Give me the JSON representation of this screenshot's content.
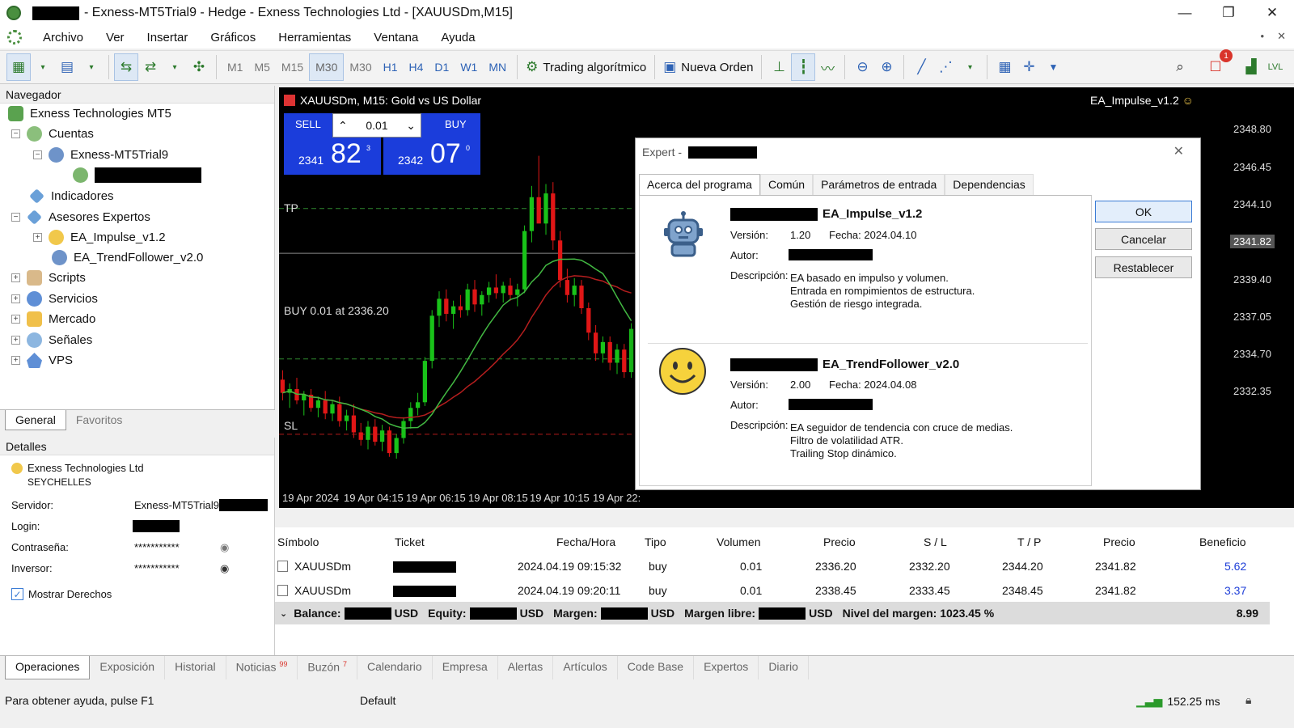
{
  "window": {
    "title": "- Exness-MT5Trial9 - Hedge - Exness Technologies Ltd - [XAUUSDm,M15]",
    "minimize": "—",
    "maximize": "❐",
    "close": "✕"
  },
  "menu": [
    "Archivo",
    "Ver",
    "Insertar",
    "Gráficos",
    "Herramientas",
    "Ventana",
    "Ayuda"
  ],
  "toolbar": {
    "timeframes": [
      "M1",
      "M5",
      "M15",
      "M30",
      "M30",
      "H1",
      "H4",
      "D1",
      "W1",
      "MN"
    ],
    "algo_trading": "Trading algorítmico",
    "new_order": "Nueva Orden",
    "notifications_count": "1",
    "lvl": "LVL"
  },
  "navigator": {
    "title": "Navegador",
    "root": "Exness Technologies MT5",
    "cuentas": "Cuentas",
    "account": "Exness-MT5Trial9",
    "indicadores": "Indicadores",
    "asesores": "Asesores Expertos",
    "ea1": "EA_Impulse_v1.2",
    "ea2": "EA_TrendFollower_v2.0",
    "scripts": "Scripts",
    "servicios": "Servicios",
    "mercado": "Mercado",
    "senales": "Señales",
    "vps": "VPS",
    "tab_general": "General",
    "tab_favoritos": "Favoritos"
  },
  "details": {
    "title": "Detalles",
    "company": "Exness Technologies Ltd",
    "country": "SEYCHELLES",
    "servidor_label": "Servidor:",
    "servidor_value": "Exness-MT5Trial9",
    "login_label": "Login:",
    "password_label": "Contraseña:",
    "password_value": "***********",
    "investor_label": "Inversor:",
    "investor_value": "***********",
    "show_rights": "Mostrar Derechos"
  },
  "chart": {
    "header": "XAUUSDm, M15: Gold vs US Dollar",
    "ea_label": "EA_Impulse_v1.2",
    "tp": "TP",
    "sl": "SL",
    "buy_line": "BUY 0.01 at 2336.20",
    "sell": "SELL",
    "buy": "BUY",
    "lot": "0.01",
    "sell_small": "2341",
    "sell_big": "82",
    "sell_sup": "3",
    "buy_small": "2342",
    "buy_big": "07",
    "buy_sup": "0",
    "y_ticks": [
      "2348.80",
      "2346.45",
      "2344.10",
      "2341.82",
      "2339.40",
      "2337.05",
      "2334.70",
      "2332.35"
    ],
    "x_ticks": [
      "19 Apr 2024",
      "19 Apr 04:15",
      "19 Apr 06:15",
      "19 Apr 08:15",
      "19 Apr 10:15",
      "19 Apr 22:"
    ]
  },
  "dialog": {
    "title": "Expert -",
    "tabs": [
      "Acerca del programa",
      "Común",
      "Parámetros de entrada",
      "Dependencias"
    ],
    "ea1": {
      "name": "EA_Impulse_v1.2",
      "version_label": "Versión:",
      "version": "1.20",
      "date": "Fecha: 2024.04.10",
      "author_label": "Autor:",
      "desc_label": "Descripción:",
      "desc": [
        "EA basado en impulso y volumen.",
        "Entrada en rompimientos de estructura.",
        "Gestión de riesgo integrada."
      ]
    },
    "ea2": {
      "name": "EA_TrendFollower_v2.0",
      "version_label": "Versión:",
      "version": "2.00",
      "date": "Fecha: 2024.04.08",
      "author_label": "Autor:",
      "desc_label": "Descripción:",
      "desc": [
        "EA seguidor de tendencia con cruce de medias.",
        "Filtro de volatilidad ATR.",
        "Trailing Stop dinámico."
      ]
    },
    "ok": "OK",
    "cancel": "Cancelar",
    "reset": "Restablecer"
  },
  "positions": {
    "headers": [
      "Símbolo",
      "Ticket",
      "Fecha/Hora",
      "Tipo",
      "Volumen",
      "Precio",
      "S / L",
      "T / P",
      "Precio",
      "Beneficio"
    ],
    "rows": [
      {
        "symbol": "XAUUSDm",
        "time": "2024.04.19 09:15:32",
        "type": "buy",
        "volume": "0.01",
        "price": "2336.20",
        "sl": "2332.20",
        "tp": "2344.20",
        "current": "2341.82",
        "profit": "5.62"
      },
      {
        "symbol": "XAUUSDm",
        "time": "2024.04.19 09:20:11",
        "type": "buy",
        "volume": "0.01",
        "price": "2338.45",
        "sl": "2333.45",
        "tp": "2348.45",
        "current": "2341.82",
        "profit": "3.37"
      }
    ],
    "balance_label": "Balance:",
    "equity_label": "Equity:",
    "margin_label": "Margen:",
    "free_margin_label": "Margen libre:",
    "usd": "USD",
    "margin_level": "Nivel del margen: 1023.45 %",
    "total_profit": "8.99"
  },
  "bottom_tabs": [
    {
      "label": "Operaciones",
      "badge": ""
    },
    {
      "label": "Exposición",
      "badge": ""
    },
    {
      "label": "Historial",
      "badge": ""
    },
    {
      "label": "Noticias",
      "badge": "99"
    },
    {
      "label": "Buzón",
      "badge": "7"
    },
    {
      "label": "Calendario",
      "badge": ""
    },
    {
      "label": "Empresa",
      "badge": ""
    },
    {
      "label": "Alertas",
      "badge": ""
    },
    {
      "label": "Artículos",
      "badge": ""
    },
    {
      "label": "Code Base",
      "badge": ""
    },
    {
      "label": "Expertos",
      "badge": ""
    },
    {
      "label": "Diario",
      "badge": ""
    }
  ],
  "status": {
    "help": "Para obtener ayuda, pulse F1",
    "profile": "Default",
    "ping": "152.25 ms"
  },
  "colors": {
    "bull": "#19c219",
    "bear": "#e01616",
    "ma_red": "#b51e1e",
    "ma_green": "#42b842",
    "trade_blue": "#1b3ddb",
    "profit_blue": "#1f3fd8"
  },
  "chart_candles": [
    [
      2335.1,
      2335.6,
      2334.0,
      2334.4
    ],
    [
      2334.4,
      2334.9,
      2333.6,
      2334.6
    ],
    [
      2334.6,
      2335.2,
      2333.8,
      2334.0
    ],
    [
      2334.0,
      2334.5,
      2333.2,
      2334.3
    ],
    [
      2334.3,
      2334.6,
      2333.4,
      2333.6
    ],
    [
      2333.6,
      2334.2,
      2333.1,
      2334.0
    ],
    [
      2334.0,
      2334.5,
      2333.0,
      2333.3
    ],
    [
      2333.3,
      2334.0,
      2332.9,
      2333.8
    ],
    [
      2333.8,
      2334.2,
      2332.6,
      2332.9
    ],
    [
      2332.9,
      2333.5,
      2332.4,
      2333.2
    ],
    [
      2333.2,
      2333.8,
      2332.0,
      2332.3
    ],
    [
      2332.3,
      2332.8,
      2331.6,
      2331.9
    ],
    [
      2331.9,
      2332.9,
      2331.4,
      2332.6
    ],
    [
      2332.6,
      2333.0,
      2331.6,
      2331.8
    ],
    [
      2331.8,
      2332.7,
      2331.3,
      2332.4
    ],
    [
      2332.4,
      2332.6,
      2331.0,
      2331.2
    ],
    [
      2331.2,
      2332.2,
      2330.9,
      2332.0
    ],
    [
      2332.0,
      2333.1,
      2331.7,
      2332.9
    ],
    [
      2332.9,
      2333.9,
      2332.5,
      2333.6
    ],
    [
      2333.6,
      2334.4,
      2333.2,
      2333.9
    ],
    [
      2333.9,
      2336.3,
      2333.7,
      2336.1
    ],
    [
      2336.1,
      2338.8,
      2335.7,
      2338.5
    ],
    [
      2338.5,
      2339.8,
      2337.9,
      2339.4
    ],
    [
      2339.4,
      2339.9,
      2338.2,
      2338.6
    ],
    [
      2338.6,
      2339.3,
      2337.8,
      2339.0
    ],
    [
      2339.0,
      2339.6,
      2338.4,
      2338.8
    ],
    [
      2338.8,
      2340.2,
      2338.5,
      2339.9
    ],
    [
      2339.9,
      2340.4,
      2338.7,
      2339.1
    ],
    [
      2339.1,
      2339.8,
      2338.5,
      2339.6
    ],
    [
      2339.6,
      2340.3,
      2339.2,
      2340.0
    ],
    [
      2340.0,
      2340.7,
      2339.4,
      2339.7
    ],
    [
      2339.7,
      2340.3,
      2339.2,
      2340.1
    ],
    [
      2340.1,
      2340.5,
      2339.3,
      2339.6
    ],
    [
      2339.6,
      2340.2,
      2339.0,
      2339.9
    ],
    [
      2339.9,
      2343.3,
      2339.7,
      2343.0
    ],
    [
      2343.0,
      2345.4,
      2342.4,
      2344.8
    ],
    [
      2344.8,
      2347.0,
      2343.9,
      2343.4
    ],
    [
      2343.4,
      2345.5,
      2342.8,
      2345.0
    ],
    [
      2345.0,
      2345.6,
      2342.0,
      2342.5
    ],
    [
      2342.5,
      2343.0,
      2340.0,
      2340.4
    ],
    [
      2340.4,
      2341.0,
      2339.2,
      2339.6
    ],
    [
      2339.6,
      2340.5,
      2339.0,
      2340.1
    ],
    [
      2340.1,
      2340.4,
      2338.6,
      2338.9
    ],
    [
      2338.9,
      2339.2,
      2337.2,
      2337.6
    ],
    [
      2337.6,
      2338.0,
      2336.1,
      2336.5
    ],
    [
      2336.5,
      2337.4,
      2336.0,
      2337.1
    ],
    [
      2337.1,
      2337.4,
      2335.6,
      2336.0
    ],
    [
      2336.0,
      2337.0,
      2335.4,
      2336.7
    ],
    [
      2336.7,
      2337.0,
      2335.2,
      2335.5
    ],
    [
      2335.5,
      2338.1,
      2335.2,
      2337.8
    ]
  ]
}
